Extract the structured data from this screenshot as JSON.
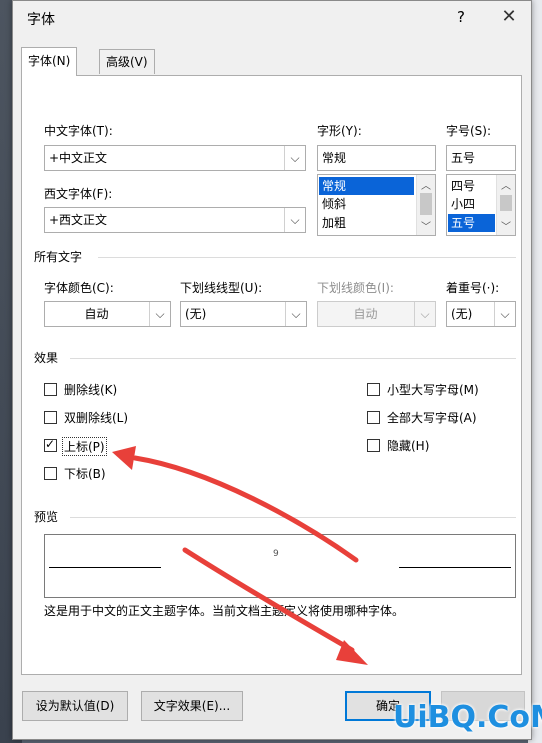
{
  "dialog": {
    "title": "字体",
    "help_label": "?",
    "close_label": "✕"
  },
  "tabs": [
    {
      "label": "字体(N)"
    },
    {
      "label": "高级(V)"
    }
  ],
  "font": {
    "chinese_label": "中文字体(T):",
    "chinese_value": "+中文正文",
    "western_label": "西文字体(F):",
    "western_value": "+西文正文",
    "style_label": "字形(Y):",
    "style_value": "常规",
    "style_options": [
      "常规",
      "倾斜",
      "加粗"
    ],
    "size_label": "字号(S):",
    "size_value": "五号",
    "size_options": [
      "四号",
      "小四",
      "五号"
    ]
  },
  "all_text": {
    "section_label": "所有文字",
    "color_label": "字体颜色(C):",
    "color_value": "自动",
    "underline_label": "下划线线型(U):",
    "underline_value": "(无)",
    "underline_color_label": "下划线颜色(I):",
    "underline_color_value": "自动",
    "emphasis_label": "着重号(·):",
    "emphasis_value": "(无)"
  },
  "effects": {
    "section_label": "效果",
    "strikethrough": {
      "label": "删除线(K)",
      "checked": false
    },
    "double_strikethrough": {
      "label": "双删除线(L)",
      "checked": false
    },
    "superscript": {
      "label": "上标(P)",
      "checked": true
    },
    "subscript": {
      "label": "下标(B)",
      "checked": false
    },
    "small_caps": {
      "label": "小型大写字母(M)",
      "checked": false
    },
    "all_caps": {
      "label": "全部大写字母(A)",
      "checked": false
    },
    "hidden": {
      "label": "隐藏(H)",
      "checked": false
    }
  },
  "preview": {
    "section_label": "预览",
    "sample": "9",
    "description": "这是用于中文的正文主题字体。当前文档主题定义将使用哪种字体。"
  },
  "buttons": {
    "set_default": "设为默认值(D)",
    "text_effects": "文字效果(E)...",
    "ok": "确定"
  },
  "annotation": {
    "arrow_color": "#e8403a"
  },
  "watermark": {
    "text": "UiBQ.CoM",
    "color": "#1e8fe0"
  }
}
